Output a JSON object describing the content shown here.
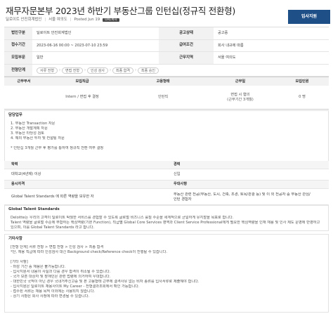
{
  "header": {
    "title": "재무자문본부 2023년 하반기 부동산그룹 인턴십(정규직 전환형)",
    "company": "딜로이트 안진회계법인",
    "location": "서울 여의도",
    "posted": "Posted Jun 19",
    "badge": "URL복사",
    "apply_label": "입사지원"
  },
  "info": {
    "rows": [
      {
        "l1": "법인구분",
        "v1": "딜로이트 안진회계법인",
        "l2": "공고상태",
        "v2": "공고중"
      },
      {
        "l1": "접수기간",
        "v1": "2023-06-16 00:00 ~ 2023-07-10 23:59",
        "l2": "급여조건",
        "v2": "회사 내규에 따름"
      },
      {
        "l1": "모집부문",
        "v1": "일반",
        "l2": "근무지역",
        "v2": "서울 여의도"
      }
    ],
    "process_label": "전형단계",
    "process": [
      "서류 전형",
      "면접 전형",
      "인성 검사",
      "최종 합격",
      "최종 승인"
    ]
  },
  "positions": {
    "headers": [
      "근무부서",
      "모집직급",
      "고용형태",
      "근무일",
      "모집인원"
    ],
    "row": [
      "",
      "Intern / 면접 후 결정",
      "인턴직",
      "면접 시 협의\n(근무기간 3개월)",
      "0 명"
    ]
  },
  "duties": {
    "title": "담당업무",
    "lines": [
      "1. 부동산 Transaction 자문",
      "2. 부동산 개발계획 자문",
      "3. 부동산 타당성 검토",
      "4. 해외 부동산 투자 및 컨설팅 자문",
      "",
      "* 인턴십 3개월 근무 후 평가를 통하여 정규직 전환 여부 결정"
    ]
  },
  "requirements": {
    "h_edu": "학력",
    "h_exp": "경력",
    "edu": "대학교(4년제) 이상",
    "exp": "신입",
    "h_cond": "응시자격",
    "h_pref": "우대사항",
    "cond": "Global Talent Standards 에 따른 역량을 보유한 자",
    "pref1": "부동산 관련 전공(부동산, 도시, 건축, 조경, 토목/관광 등) 및 이 외 전공자 중 부동산 관심/",
    "pref2": "인턴 경험자"
  },
  "gts": {
    "title": "Global Talent Standards",
    "lines": [
      "Deloitte는 우리의 고객이 딜로이트 탁월한 서비스를 경험할 수 있도록 글로벌 비즈니스 룰칠 수준을 세계적으로 균일하게 유지할을 목표로 합니다.",
      "Talent 역량을 글로벌 수준에 부합하는 핵심역량(기본 Function), 직급별 Global Core Services 영역과 Client Service Professional에게 필요한 핵심역량을 인재 채용 및 인사 제도 운영에 반영하고",
      "있으며, 이를 Global Talent Standards 라고 합니다."
    ]
  },
  "other": {
    "title": "기타사항",
    "lines": [
      "[전형 단계] 서류 전형 > 면접 전형 > 인성 검사 > 최종 합격",
      "*단, 채용 직급에 따라 인성검사 대신 Background check/Reference check이 진행될 수 있습니다.",
      "",
      "[기타 사항]",
      "- 마감 기간 중 채용은 불가능합니다.",
      "- 입사지원서 내용이 사실과 다를 경우 합격이 취소될 수 있습니다.",
      "- 국가 보훈 대상자 및 장애인은 관련 법령에 의거하여 우대합니다.",
      "- 대한민국 국적이 아닌 경우 국내거주신고증 및 본 고용형태 근무에 결격사유 없는 비자 종류를 입사서류로 제출해야 합니다.",
      "- 입사지원은 딜로이트 채용사이트 My Career - 전형결과조회에서 확인 가능합니다.",
      "- 접수된 서류는 채용 목적 이외에는 사용되지 않습니다.",
      "- 상기 사항은 회사 사정에 따라 변경될 수 있습니다."
    ]
  }
}
